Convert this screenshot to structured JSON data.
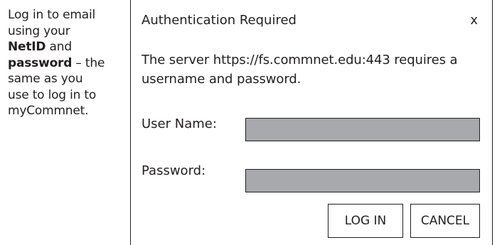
{
  "instruction": {
    "line1": "Log in to email",
    "line2": "using your",
    "netid": "NetID",
    "and_text": " and",
    "password_word": "password",
    "line4_rest": " – the",
    "line5": "same as you",
    "line6": "use to log in to",
    "line7": "myCommnet."
  },
  "dialog": {
    "title": "Authentication Required",
    "close_label": "x",
    "message": "The server https://fs.commnet.edu:443 requires a username and password.",
    "username_label": "User Name:",
    "username_value": "",
    "password_label": "Password:",
    "password_value": "",
    "login_label": "LOG IN",
    "cancel_label": "CANCEL"
  },
  "colors": {
    "text": "#231f20",
    "input_fill": "#a7a9ac",
    "background": "#ffffff"
  }
}
